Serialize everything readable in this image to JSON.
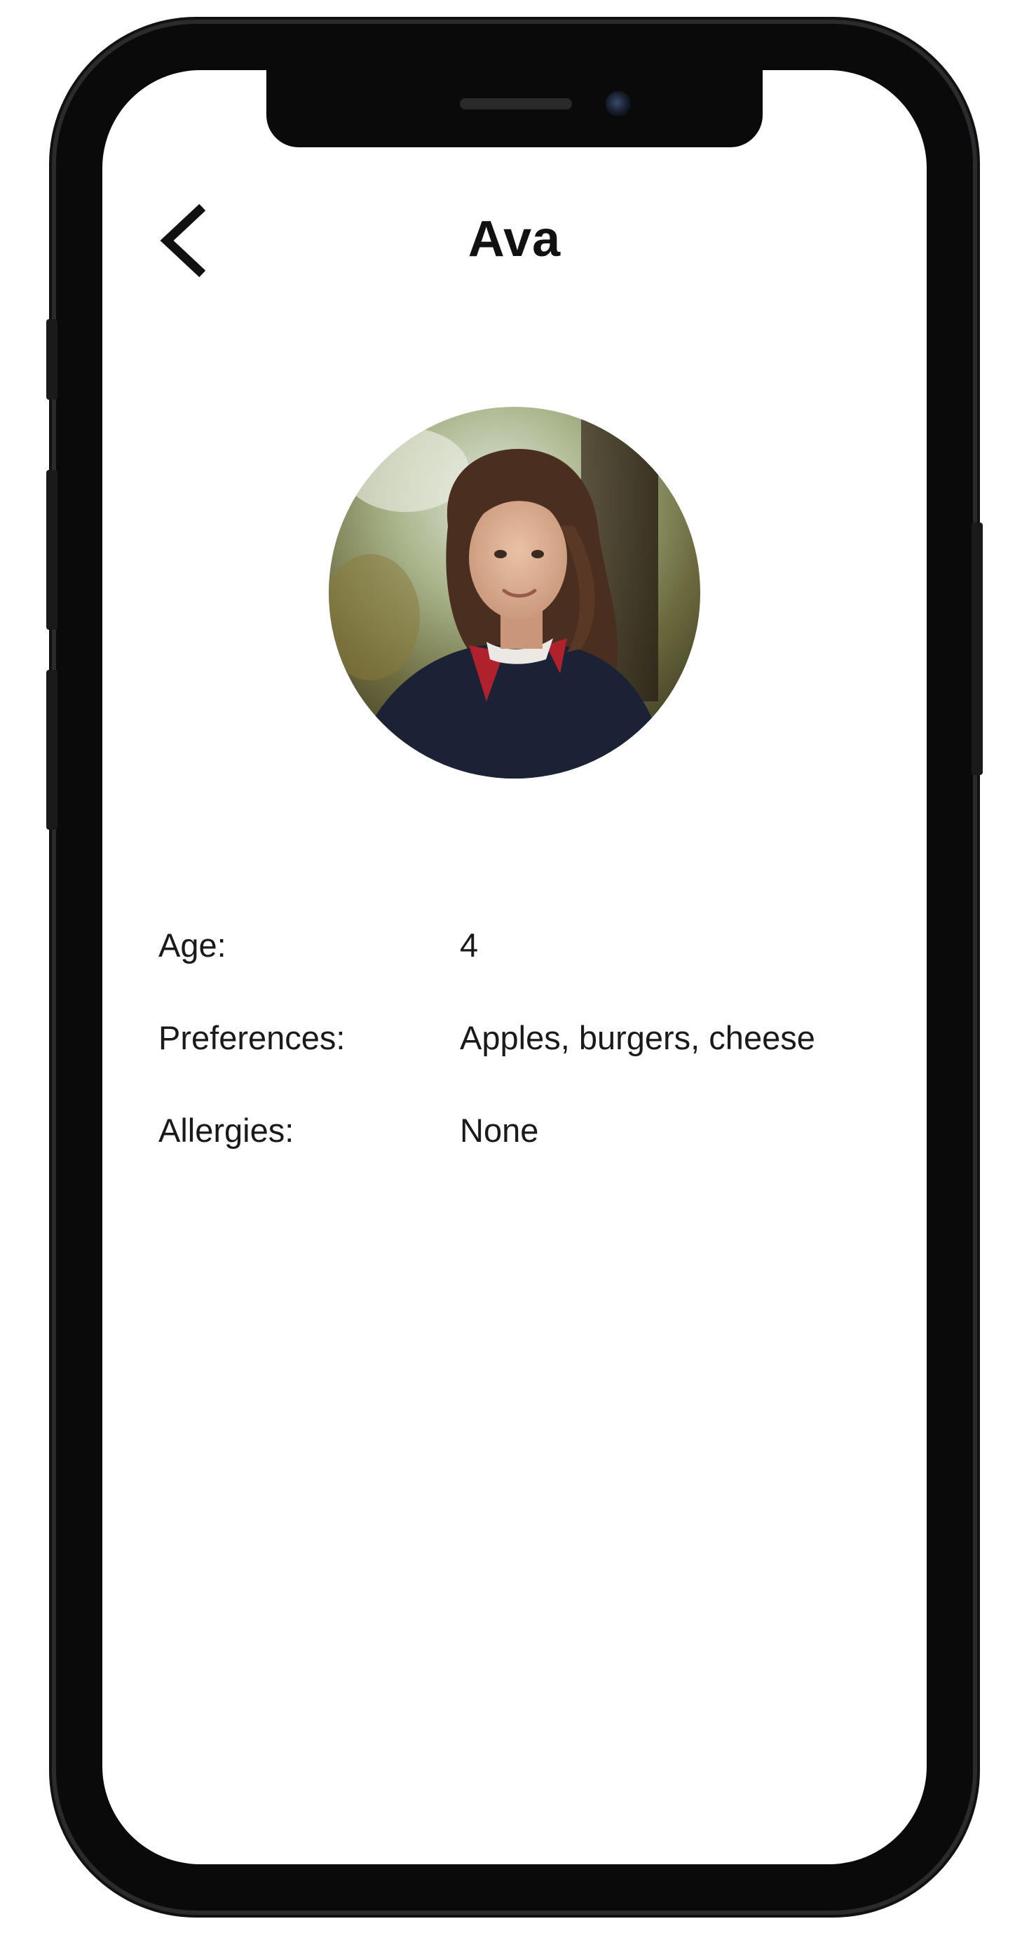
{
  "profile": {
    "name": "Ava",
    "photo_alt": "child-portrait"
  },
  "details": [
    {
      "label": "Age:",
      "value": "4"
    },
    {
      "label": "Preferences:",
      "value": "Apples, burgers, cheese"
    },
    {
      "label": "Allergies:",
      "value": "None"
    }
  ],
  "icons": {
    "back": "chevron-left-icon"
  },
  "colors": {
    "frame": "#0a0a0a",
    "screen": "#ffffff",
    "text": "#1a1a1a"
  }
}
